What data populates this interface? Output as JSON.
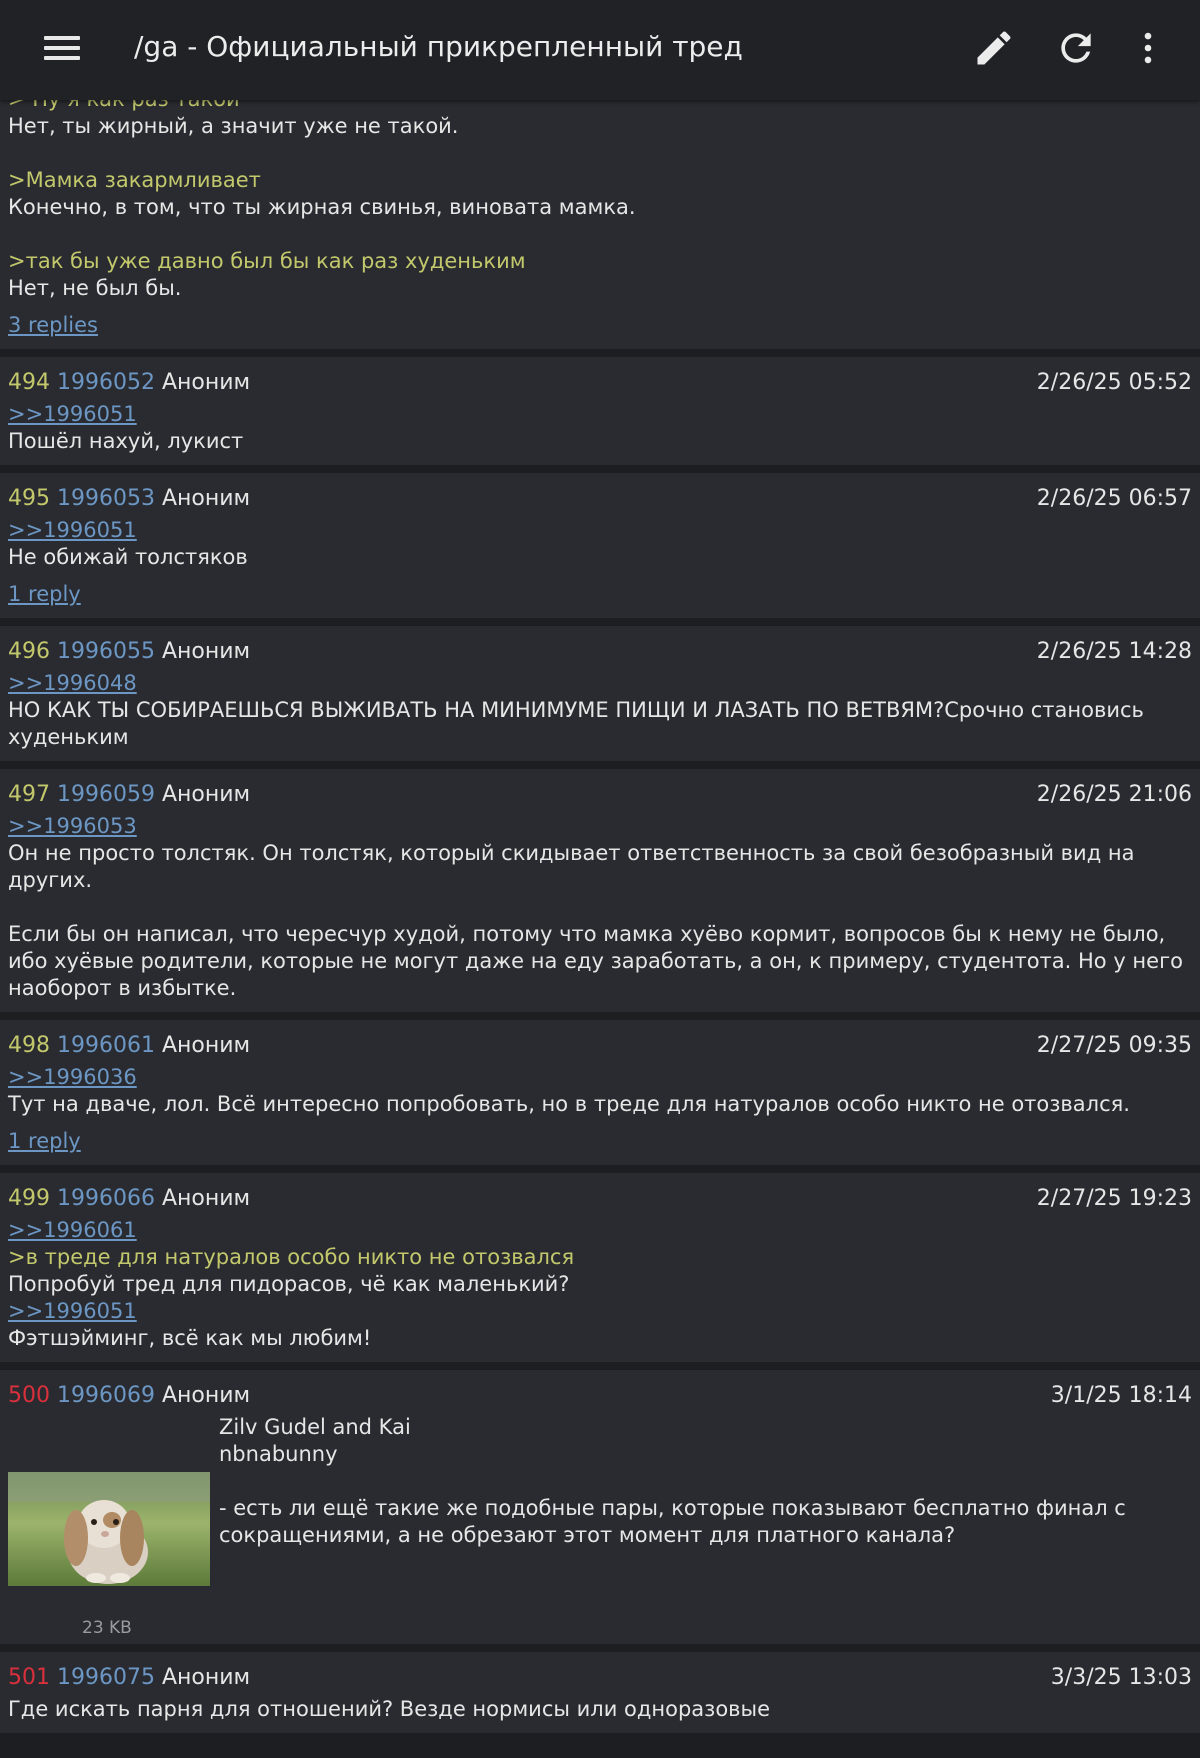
{
  "app_bar": {
    "title": "/ga - Официальный прикрепленный тред",
    "menu_icon": "hamburger-menu-icon",
    "edit_icon": "pencil-icon",
    "refresh_icon": "refresh-icon",
    "more_icon": "more-vertical-icon"
  },
  "colors": {
    "background": "#1d1e22",
    "post_background": "#2a2b30",
    "greentext": "#c2c86b",
    "link": "#6c97c4",
    "post_number_over_limit": "#d8303c"
  },
  "first_post": {
    "lines": [
      {
        "text": "> Ну я как раз такой",
        "kind": "green"
      },
      {
        "text": "Нет, ты жирный, а значит уже не такой.",
        "kind": "text"
      },
      {
        "text": "",
        "kind": "empty"
      },
      {
        "text": ">Мамка закармливает",
        "kind": "green"
      },
      {
        "text": "Конечно, в том, что ты жирная свинья, виновата мамка.",
        "kind": "text"
      },
      {
        "text": "",
        "kind": "empty"
      },
      {
        "text": ">так бы уже давно был бы как раз худеньким",
        "kind": "green"
      },
      {
        "text": "Нет, не был бы.",
        "kind": "text"
      }
    ],
    "replies": "3 replies"
  },
  "posts": [
    {
      "num": "494",
      "id": "1996052",
      "author": "Аноним",
      "date": "2/26/25 05:52",
      "lines": [
        {
          "text": ">>1996051",
          "kind": "link"
        },
        {
          "text": "Пошёл нахуй, лукист",
          "kind": "text"
        }
      ],
      "replies": ""
    },
    {
      "num": "495",
      "id": "1996053",
      "author": "Аноним",
      "date": "2/26/25 06:57",
      "lines": [
        {
          "text": ">>1996051",
          "kind": "link"
        },
        {
          "text": "Не обижай толстяков",
          "kind": "text"
        }
      ],
      "replies": "1 reply"
    },
    {
      "num": "496",
      "id": "1996055",
      "author": "Аноним",
      "date": "2/26/25 14:28",
      "lines": [
        {
          "text": ">>1996048",
          "kind": "link"
        },
        {
          "text": "НО КАК ТЫ СОБИРАЕШЬСЯ ВЫЖИВАТЬ НА МИНИМУМЕ ПИЩИ И ЛАЗАТЬ ПО ВЕТВЯМ?Срочно становись",
          "kind": "text"
        },
        {
          "text": "худеньким",
          "kind": "text"
        }
      ],
      "replies": ""
    },
    {
      "num": "497",
      "id": "1996059",
      "author": "Аноним",
      "date": "2/26/25 21:06",
      "lines": [
        {
          "text": ">>1996053",
          "kind": "link"
        },
        {
          "text": "Он не просто толстяк. Он толстяк, который скидывает ответственность за свой безобразный вид на",
          "kind": "text"
        },
        {
          "text": "других.",
          "kind": "text"
        },
        {
          "text": "",
          "kind": "empty"
        },
        {
          "text": "Если бы он написал, что чересчур худой, потому что мамка хуёво кормит, вопросов бы к нему не было,",
          "kind": "text"
        },
        {
          "text": "ибо хуёвые родители, которые не могут даже на еду заработать, а он, к примеру, студентота. Но у него",
          "kind": "text"
        },
        {
          "text": "наоборот в избытке.",
          "kind": "text"
        }
      ],
      "replies": ""
    },
    {
      "num": "498",
      "id": "1996061",
      "author": "Аноним",
      "date": "2/27/25 09:35",
      "lines": [
        {
          "text": ">>1996036",
          "kind": "link"
        },
        {
          "text": "Тут на дваче, лол. Всё интересно попробовать, но в треде для натуралов особо никто не отозвался.",
          "kind": "text"
        }
      ],
      "replies": "1 reply"
    },
    {
      "num": "499",
      "id": "1996066",
      "author": "Аноним",
      "date": "2/27/25 19:23",
      "lines": [
        {
          "text": ">>1996061",
          "kind": "link"
        },
        {
          "text": ">в треде для натуралов особо никто не отозвался",
          "kind": "green"
        },
        {
          "text": "Попробуй тред для пидорасов, чё как маленький?",
          "kind": "text"
        },
        {
          "text": ">>1996051",
          "kind": "link"
        },
        {
          "text": "Фэтшэйминг, всё как мы любим!",
          "kind": "text"
        }
      ],
      "replies": ""
    }
  ],
  "image_post": {
    "num": "500",
    "id": "1996069",
    "author": "Аноним",
    "date": "3/1/25 18:14",
    "thumbnail_icon": "bunny-photo-thumbnail",
    "lines": [
      {
        "text": "Zilv Gudel and Kai",
        "kind": "text"
      },
      {
        "text": "nbnabunny",
        "kind": "text"
      },
      {
        "text": "",
        "kind": "empty"
      },
      {
        "text": "- есть ли ещё такие же подобные пары, которые показывают бесплатно финал с",
        "kind": "text"
      },
      {
        "text": "сокращениями, а не обрезают этот момент для платного канала?",
        "kind": "text"
      }
    ],
    "file_size": "23 KB"
  },
  "last_post": {
    "num": "501",
    "id": "1996075",
    "author": "Аноним",
    "date": "3/3/25 13:03",
    "lines": [
      {
        "text": "Где искать парня для отношений? Везде нормисы или одноразовые",
        "kind": "text"
      }
    ]
  }
}
